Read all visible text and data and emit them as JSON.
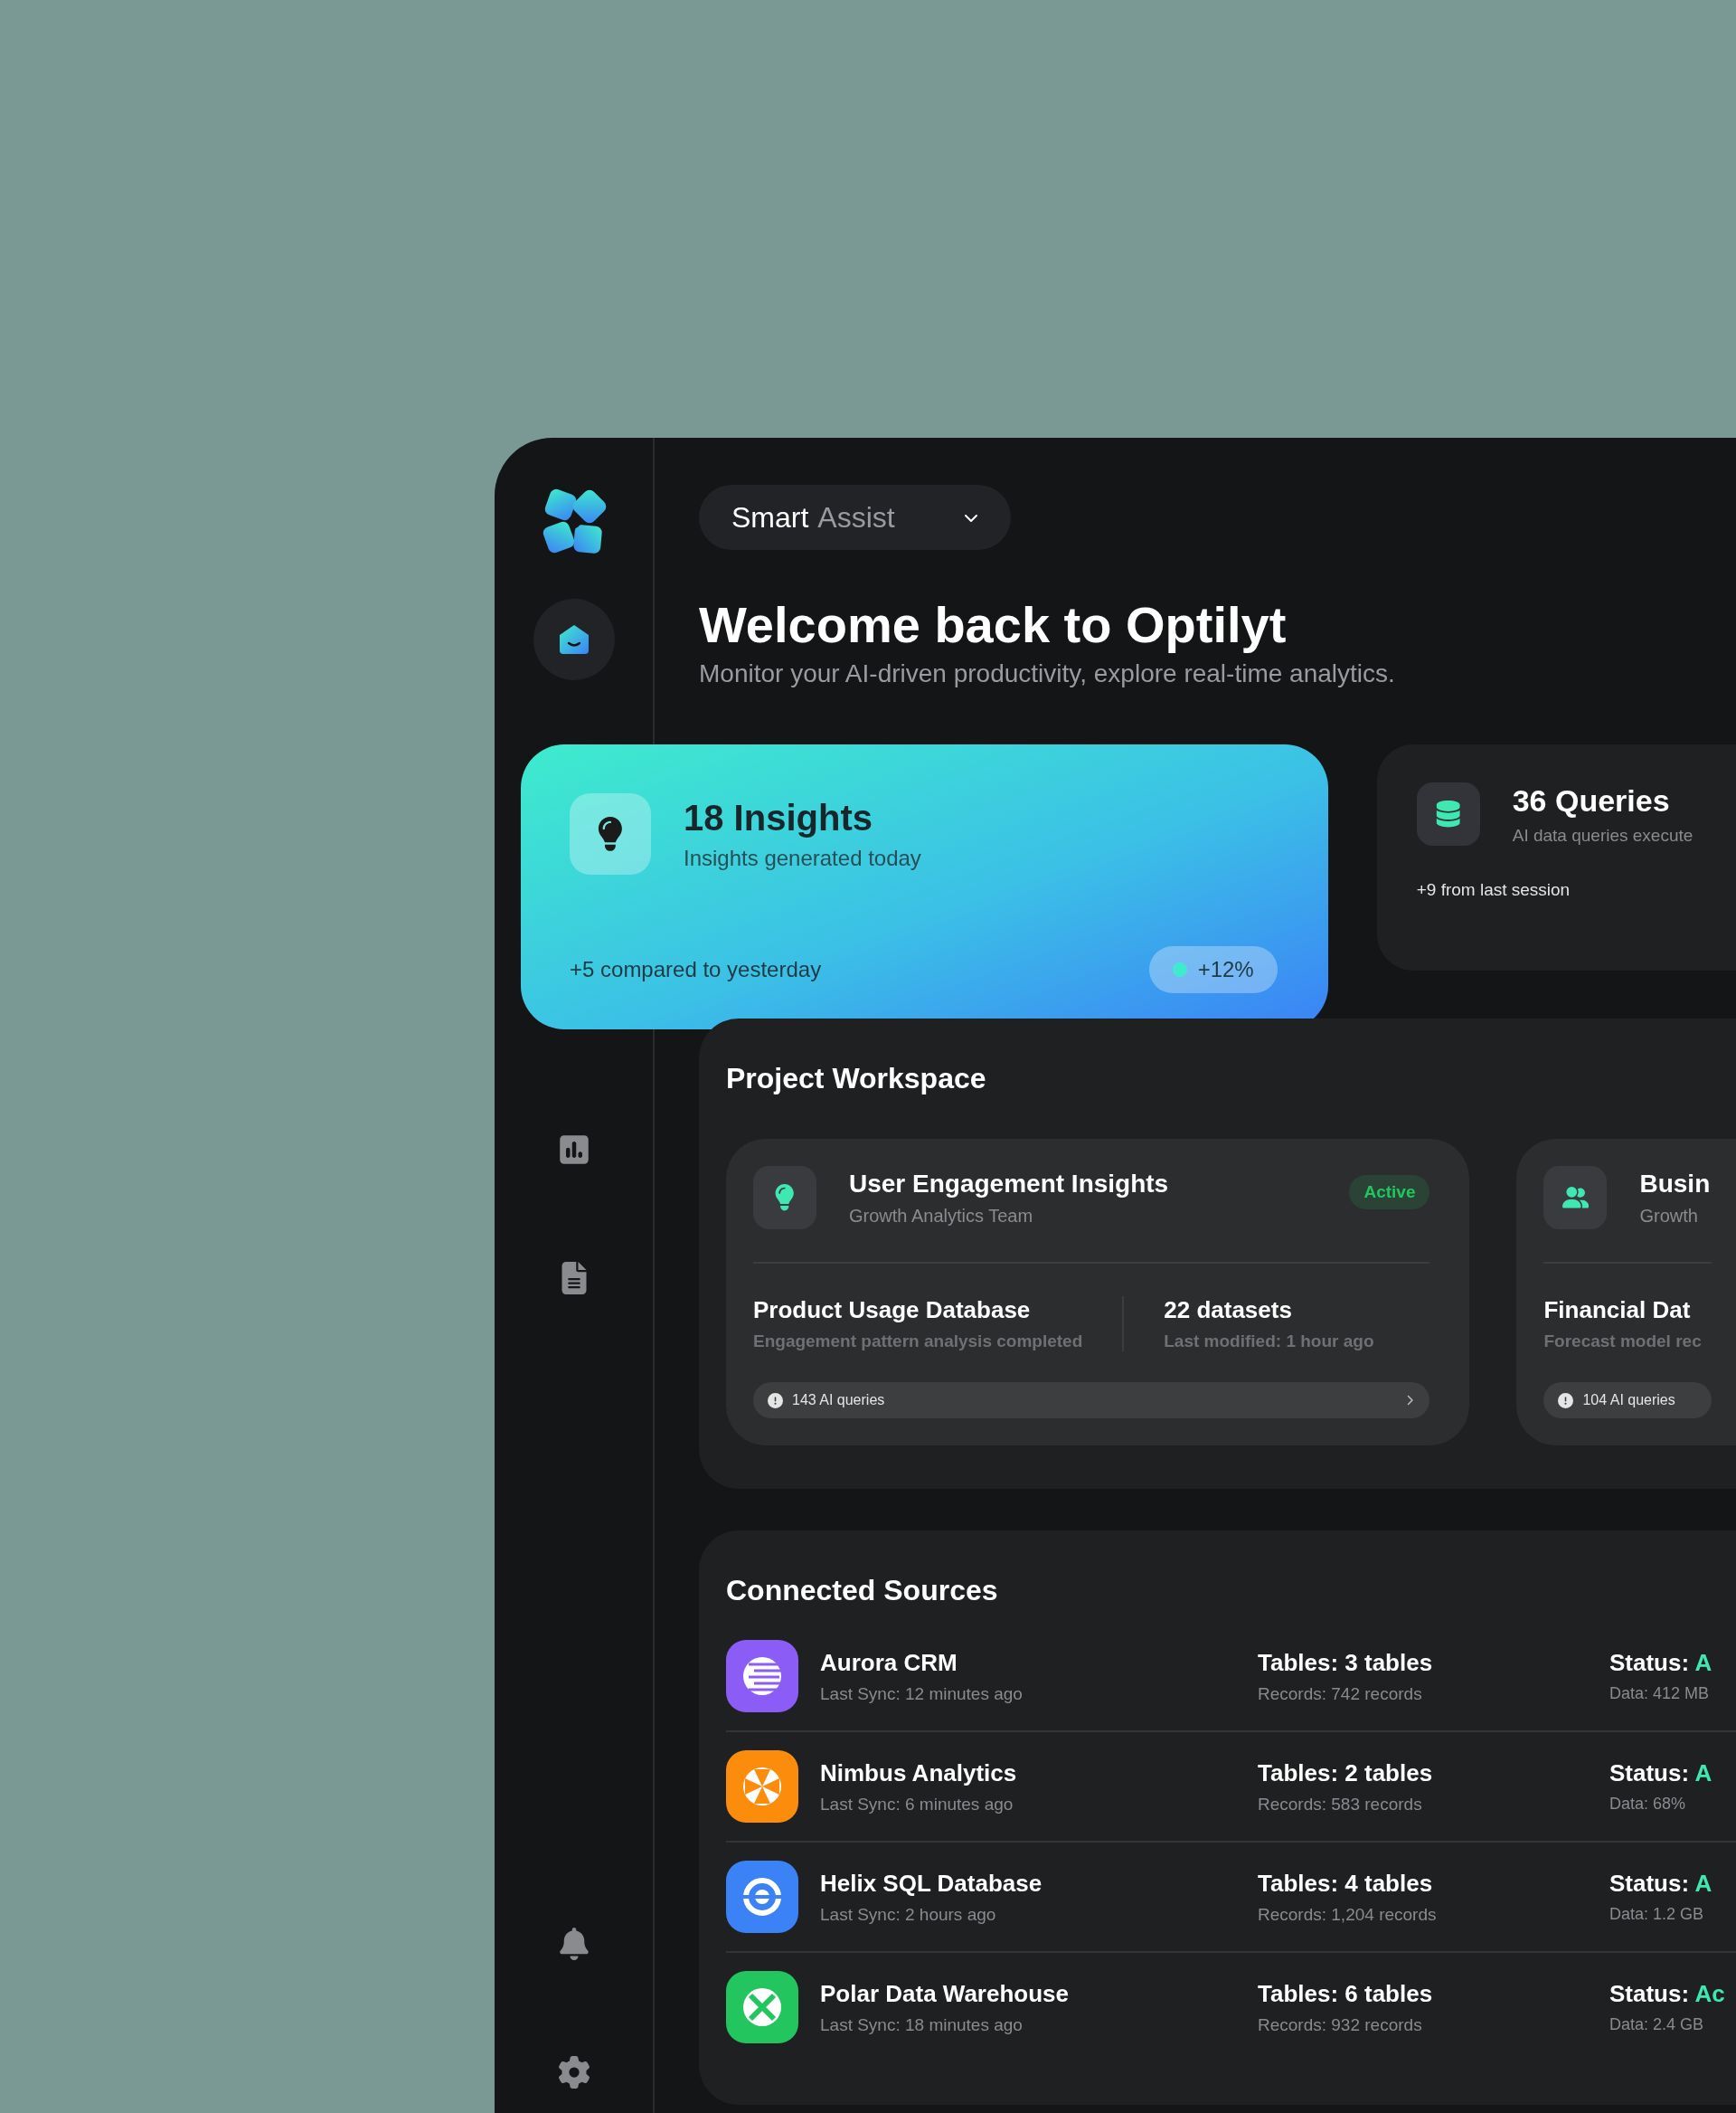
{
  "sidebar": {
    "top_items": [
      {
        "kind": "home",
        "selected": true
      },
      {
        "kind": "chart",
        "selected": false
      },
      {
        "kind": "document",
        "selected": false
      }
    ],
    "bottom_items": [
      {
        "kind": "notifications",
        "selected": false
      },
      {
        "kind": "settings",
        "selected": false
      }
    ]
  },
  "assistant_select": {
    "label": "Smart",
    "label_suffix": "Assist"
  },
  "header": {
    "title": "Welcome back to Optilyt",
    "subtitle": "Monitor your AI-driven productivity, explore real-time analytics."
  },
  "stats": [
    {
      "kind": "featured",
      "title": "18 Insights",
      "subtitle": "Insights generated today",
      "note": "+5 compared to yesterday",
      "change": "+12%"
    },
    {
      "kind": "plain",
      "title": "36 Queries",
      "subtitle": "AI data queries execute",
      "note": "+9 from last session"
    }
  ],
  "workspace": {
    "title": "Project Workspace",
    "projects": [
      {
        "kind": "insight",
        "title": "User Engagement Insights",
        "team": "Growth Analytics Team",
        "status": "Active",
        "source": "Product Usage Database",
        "source_note": "Engagement pattern analysis completed",
        "datasets": "22 datasets",
        "modified": "Last modified: 1 hour ago",
        "queries": "143 AI queries"
      },
      {
        "kind": "team",
        "title": "Busin",
        "team": "Growth",
        "source": "Financial Dat",
        "source_note": "Forecast model rec",
        "queries": "104 AI queries"
      }
    ]
  },
  "sources": {
    "title": "Connected Sources",
    "items": [
      {
        "kind": "stripes",
        "color": "#8b5cf6",
        "name": "Aurora CRM",
        "sync": "Last Sync: 12 minutes ago",
        "tables": "Tables: 3 tables",
        "records": "Records: 742 records",
        "status_label": "Status:",
        "status": "A",
        "data": "Data: 412 MB"
      },
      {
        "kind": "cross",
        "color": "#fb8c0c",
        "name": "Nimbus Analytics",
        "sync": "Last Sync: 6 minutes ago",
        "tables": "Tables: 2 tables",
        "records": "Records: 583 records",
        "status_label": "Status:",
        "status": "A",
        "data": "Data: 68%"
      },
      {
        "kind": "ring",
        "color": "#3b82f6",
        "name": "Helix SQL Database",
        "sync": "Last Sync: 2 hours ago",
        "tables": "Tables: 4 tables",
        "records": "Records: 1,204 records",
        "status_label": "Status:",
        "status": "A",
        "data": "Data: 1.2 GB"
      },
      {
        "kind": "x",
        "color": "#22c55e",
        "name": "Polar Data Warehouse",
        "sync": "Last Sync: 18 minutes ago",
        "tables": "Tables: 6 tables",
        "records": "Records: 932 records",
        "status_label": "Status:",
        "status": "Ac",
        "data": "Data: 2.4 GB"
      }
    ]
  }
}
